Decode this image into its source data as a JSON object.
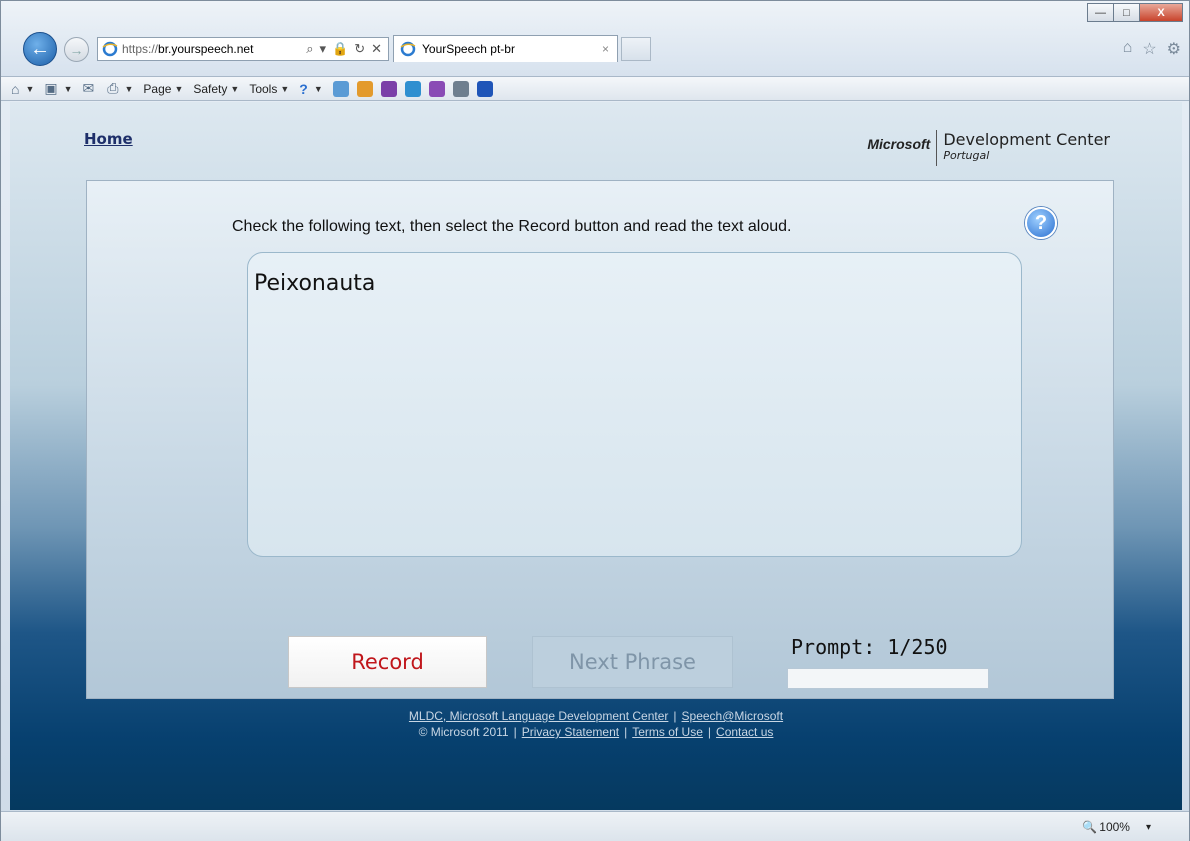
{
  "window": {
    "minimize_glyph": "—",
    "maximize_glyph": "□",
    "close_glyph": "X"
  },
  "address_bar": {
    "url_prefix": "https://",
    "url_host": "br.yourspeech.net",
    "tool_glyphs": [
      "⌕",
      "▾",
      "🔒",
      "↻",
      "✕"
    ]
  },
  "tab": {
    "title": "YourSpeech pt-br",
    "close_glyph": "×"
  },
  "command_bar": {
    "items": [
      {
        "icon": "home-icon",
        "glyph": "⌂",
        "label": ""
      },
      {
        "icon": "feeds-icon",
        "glyph": "▣",
        "label": ""
      },
      {
        "icon": "mail-icon",
        "glyph": "✉",
        "label": ""
      },
      {
        "icon": "print-icon",
        "glyph": "⎙",
        "label": ""
      },
      {
        "icon": "",
        "glyph": "",
        "label": "Page"
      },
      {
        "icon": "",
        "glyph": "",
        "label": "Safety"
      },
      {
        "icon": "",
        "glyph": "",
        "label": "Tools"
      },
      {
        "icon": "help-icon",
        "glyph": "?",
        "label": ""
      }
    ]
  },
  "page": {
    "home_link": "Home",
    "brand": {
      "company": "Microsoft",
      "title": "Development Center",
      "subtitle": "Portugal"
    },
    "instruction": "Check the following text, then select the Record button and read the text aloud.",
    "help_glyph": "?",
    "prompt_text": "Peixonauta",
    "record_label": "Record",
    "next_label": "Next Phrase",
    "counter": "Prompt: 1/250",
    "progress_fraction": 0.0,
    "footer": {
      "line1_a": "MLDC, Microsoft Language Development Center",
      "line1_sep": "|",
      "line1_b": "Speech@Microsoft",
      "line2_copyright": "© Microsoft 2011",
      "line2_sep1": "|",
      "line2_privacy": "Privacy Statement",
      "line2_sep2": "|",
      "line2_terms": "Terms of Use",
      "line2_sep3": "|",
      "line2_contact": "Contact us"
    }
  },
  "status_bar": {
    "zoom": "100%",
    "zoom_dropdown_glyph": "▾"
  },
  "colors": {
    "record_text": "#c0161b",
    "link": "#1e2f6a"
  }
}
